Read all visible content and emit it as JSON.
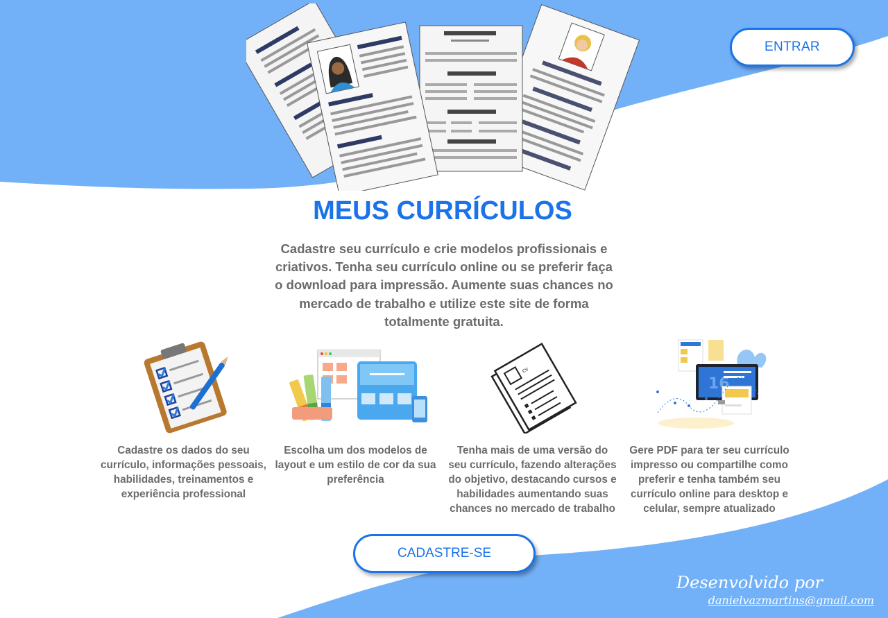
{
  "colors": {
    "accent": "#1a73e8",
    "wave": "#72b1f8",
    "text": "#6b6b6b"
  },
  "header": {
    "login_label": "ENTRAR"
  },
  "hero": {
    "title": "MEUS CURRÍCULOS",
    "description": "Cadastre seu currículo e crie modelos profissionais e criativos. Tenha seu currículo online ou se preferir faça o download para impressão. Aumente suas chances no mercado de trabalho e utilize este site de forma totalmente gratuita."
  },
  "features": [
    {
      "icon": "clipboard-checklist-icon",
      "text": "Cadastre os dados do seu currículo, informações pessoais, habilidades, treinamentos e experiência professional"
    },
    {
      "icon": "layout-palette-icon",
      "text": "Escolha um dos modelos de layout e um estilo de cor da sua preferência"
    },
    {
      "icon": "cv-documents-icon",
      "text": "Tenha mais de uma versão do seu currículo, fazendo alterações do objetivo, destacando cursos e habilidades aumentando suas chances no mercado de trabalho"
    },
    {
      "icon": "multi-device-icon",
      "text": "Gere PDF para ter seu currículo impresso ou compartilhe como preferir e tenha também seu currículo online para desktop e celular, sempre atualizado"
    }
  ],
  "signup_label": "CADASTRE-SE",
  "footer": {
    "developed_by": "Desenvolvido por",
    "email": "danielvazmartins@gmail.com"
  }
}
